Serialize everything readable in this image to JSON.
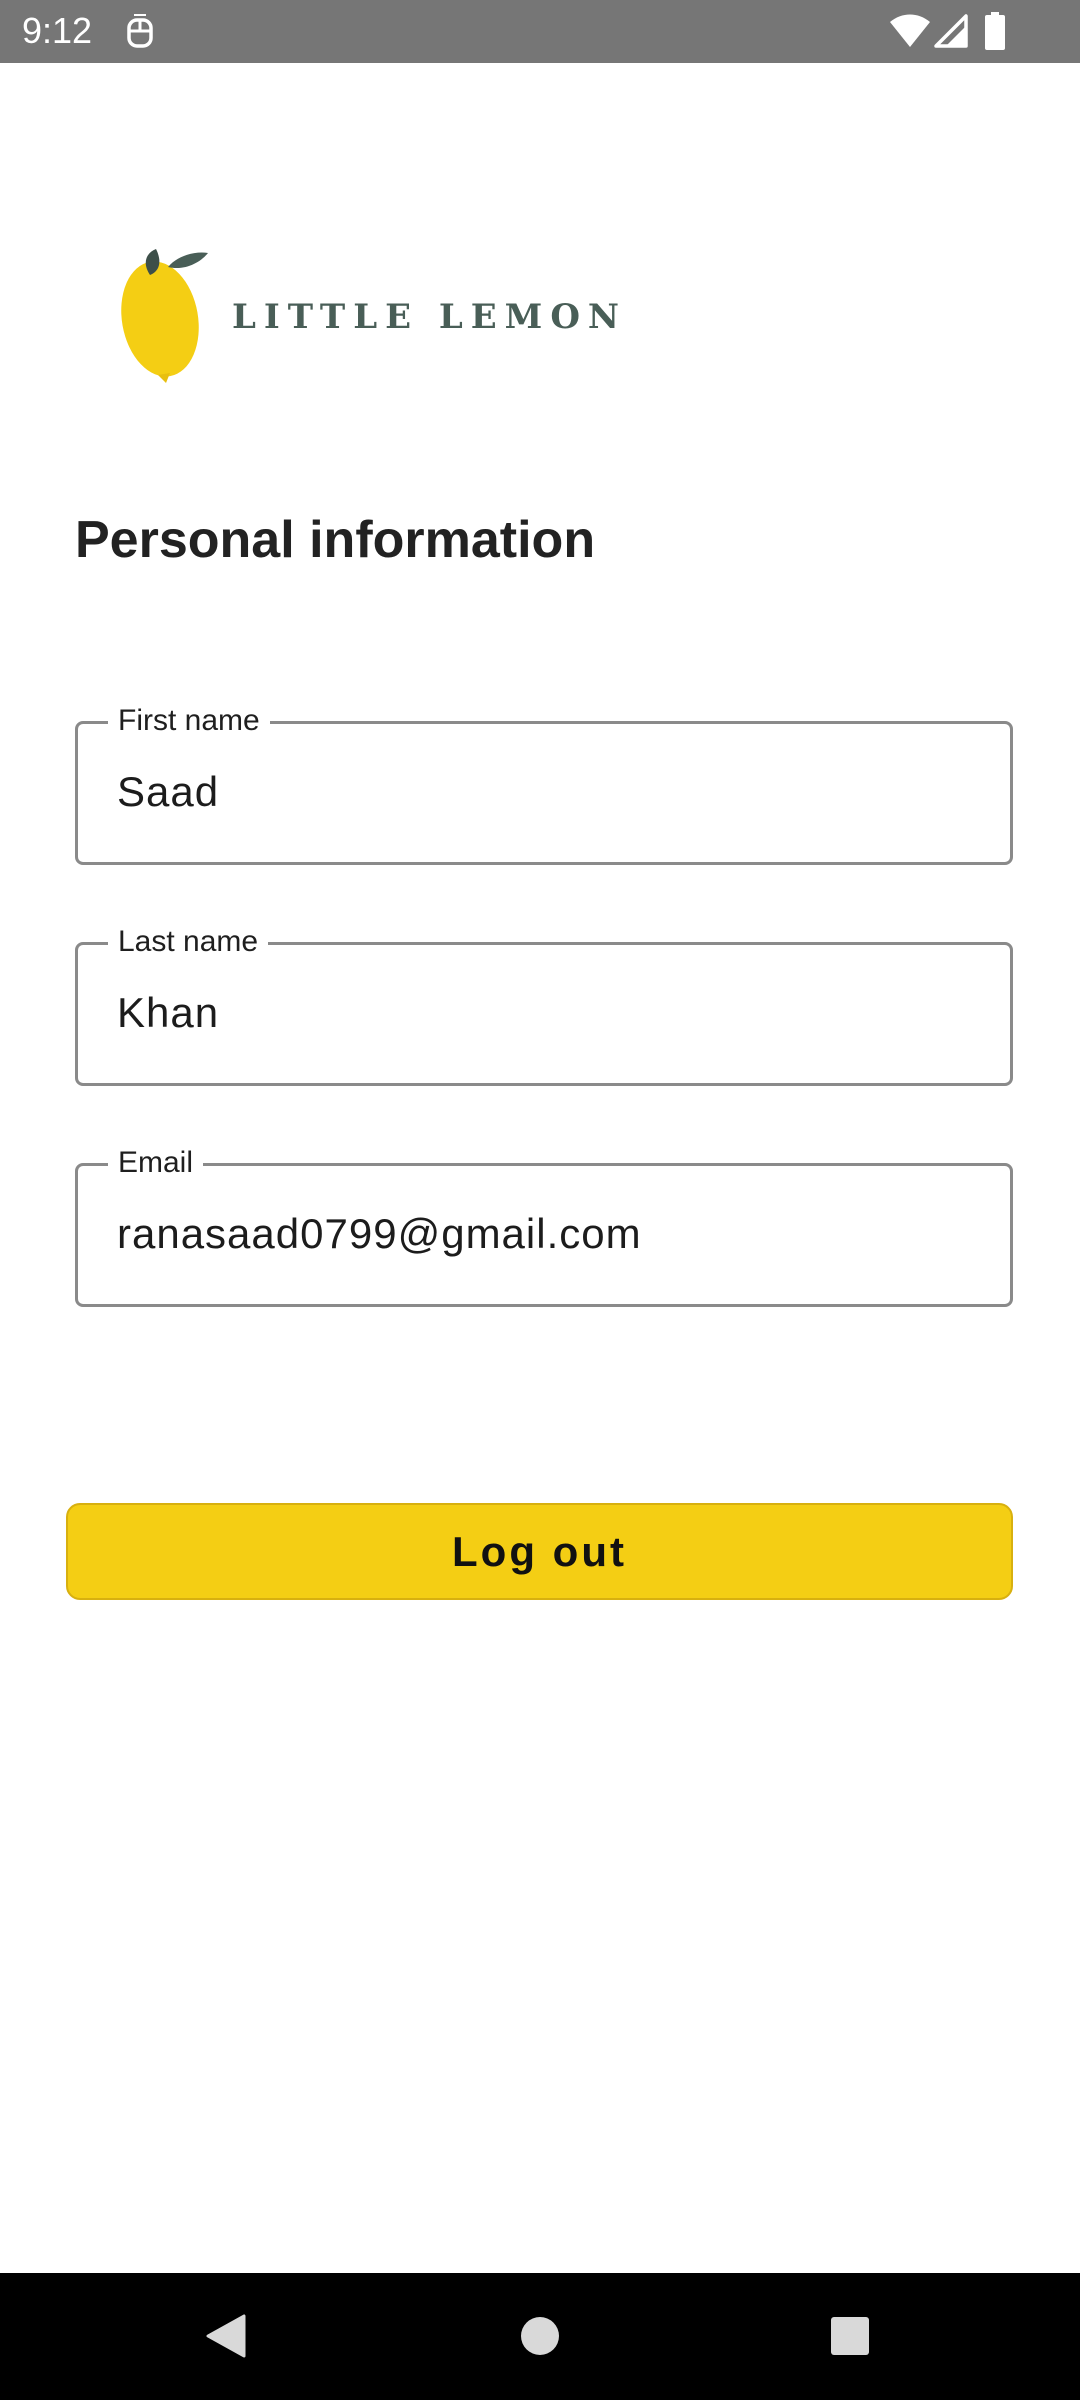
{
  "status_bar": {
    "time": "9:12",
    "icons": [
      "notification-icon",
      "wifi-icon",
      "signal-icon",
      "battery-icon"
    ]
  },
  "logo": {
    "text": "LITTLE LEMON",
    "icon": "lemon-icon"
  },
  "page": {
    "title": "Personal information"
  },
  "fields": {
    "first_name": {
      "label": "First name",
      "value": "Saad"
    },
    "last_name": {
      "label": "Last name",
      "value": "Khan"
    },
    "email": {
      "label": "Email",
      "value": "ranasaad0799@gmail.com"
    }
  },
  "actions": {
    "logout_label": "Log out"
  },
  "nav_bar": {
    "icons": [
      "back-icon",
      "home-icon",
      "recents-icon"
    ]
  },
  "colors": {
    "accent_yellow": "#f4ce14",
    "brand_green": "#495e57",
    "status_bar": "#767676",
    "field_border": "#8a8a8a"
  }
}
